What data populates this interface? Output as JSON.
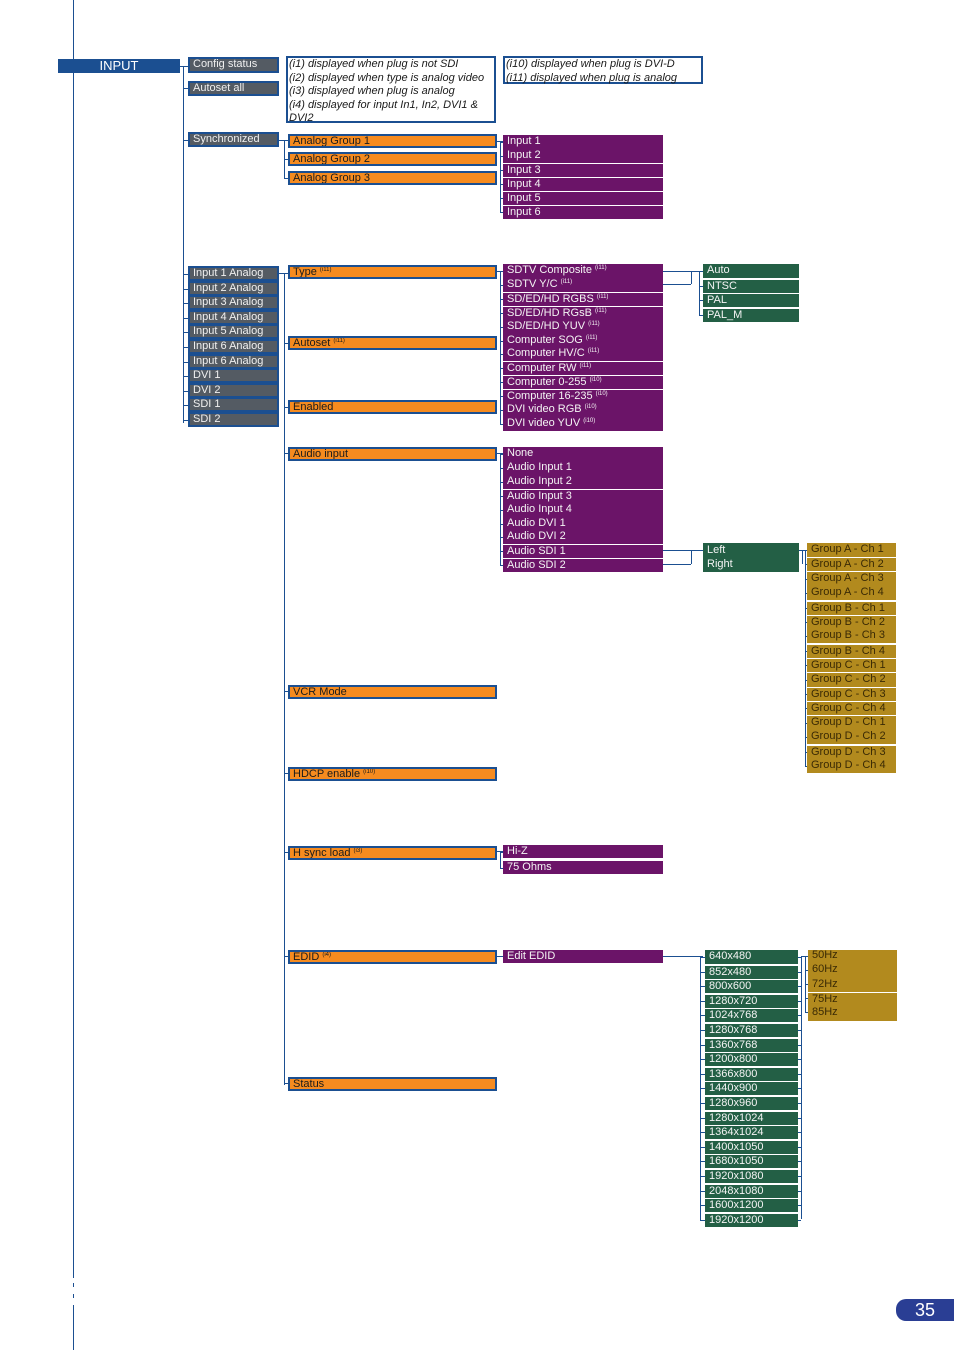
{
  "root": {
    "label": "INPUT"
  },
  "level1": {
    "config_status": "Config status",
    "autoset_all": "Autoset all",
    "synchronized": "Synchronized",
    "inputs": [
      "Input 1 Analog",
      "Input 2 Analog",
      "Input 3 Analog",
      "Input 4 Analog",
      "Input 5 Analog",
      "Input 6 Analog",
      "Input 6 Analog",
      "DVI 1",
      "DVI 2",
      "SDI 1",
      "SDI 2"
    ]
  },
  "notes": {
    "left": [
      "(i1) displayed when plug is not SDI",
      "(i2) displayed when type is analog video",
      "(i3) displayed when plug is analog",
      "(i4) displayed for input In1, In2, DVI1 &",
      "DVI2"
    ],
    "right": [
      "(i10) displayed when plug is DVI-D",
      "(i11) displayed when plug is analog"
    ]
  },
  "analog_groups": [
    "Analog Group 1",
    "Analog Group 2",
    "Analog Group 3"
  ],
  "group_inputs": [
    "Input 1",
    "Input 2",
    "Input 3",
    "Input 4",
    "Input 5",
    "Input 6"
  ],
  "settings": {
    "type": {
      "label": "Type",
      "sup": "(i11)"
    },
    "autoset": {
      "label": "Autoset",
      "sup": "(i11)"
    },
    "enabled": {
      "label": "Enabled"
    },
    "audio_input": {
      "label": "Audio input"
    },
    "vcr_mode": {
      "label": "VCR Mode"
    },
    "hdcp_enable": {
      "label": "HDCP enable",
      "sup": "(i10)"
    },
    "h_sync_load": {
      "label": "H sync load",
      "sup": "(i3)"
    },
    "edid": {
      "label": "EDID",
      "sup": "(i4)"
    },
    "status": {
      "label": "Status"
    }
  },
  "types": [
    {
      "label": "SDTV Composite",
      "sup": "(i11)"
    },
    {
      "label": "SDTV Y/C",
      "sup": "(i11)"
    },
    {
      "label": "SD/ED/HD RGBS",
      "sup": "(i11)"
    },
    {
      "label": "SD/ED/HD RGsB",
      "sup": "(i11)"
    },
    {
      "label": "SD/ED/HD YUV",
      "sup": "(i11)"
    },
    {
      "label": "Computer SOG",
      "sup": "(i11)"
    },
    {
      "label": "Computer HV/C",
      "sup": "(i11)"
    },
    {
      "label": "Computer RW",
      "sup": "(i11)"
    },
    {
      "label": "Computer 0-255",
      "sup": "(i10)"
    },
    {
      "label": "Computer 16-235",
      "sup": "(i10)"
    },
    {
      "label": "DVI video RGB",
      "sup": "(i10)"
    },
    {
      "label": "DVI video YUV",
      "sup": "(i10)"
    }
  ],
  "video_standards": [
    "Auto",
    "NTSC",
    "PAL",
    "PAL_M"
  ],
  "audio_sources": [
    "None",
    "Audio Input 1",
    "Audio Input 2",
    "Audio Input 3",
    "Audio Input 4",
    "Audio DVI 1",
    "Audio DVI 2",
    "Audio SDI 1",
    "Audio SDI 2"
  ],
  "channels_lr": [
    "Left",
    "Right"
  ],
  "sdi_groups": [
    "Group A - Ch 1",
    "Group A - Ch 2",
    "Group A - Ch 3",
    "Group A - Ch 4",
    "Group B - Ch 1",
    "Group B - Ch 2",
    "Group B - Ch 3",
    "Group B - Ch 4",
    "Group C - Ch 1",
    "Group C - Ch 2",
    "Group C - Ch 3",
    "Group C - Ch 4",
    "Group D - Ch 1",
    "Group D - Ch 2",
    "Group D - Ch 3",
    "Group D - Ch 4"
  ],
  "hsync_options": [
    "Hi-Z",
    "75 Ohms"
  ],
  "edit_edid": "Edit EDID",
  "resolutions": [
    "640x480",
    "852x480",
    "800x600",
    "1280x720",
    "1024x768",
    "1280x768",
    "1360x768",
    "1200x800",
    "1366x800",
    "1440x900",
    "1280x960",
    "1280x1024",
    "1364x1024",
    "1400x1050",
    "1680x1050",
    "1920x1080",
    "2048x1080",
    "1600x1200",
    "1920x1200"
  ],
  "refresh_rates": [
    "50Hz",
    "60Hz",
    "72Hz",
    "75Hz",
    "85Hz"
  ],
  "page_number": "35",
  "colors": {
    "blue": "#1b4f91",
    "orange": "#f68b1f",
    "purple": "#6b1468",
    "green": "#235f45",
    "gold": "#b28a1e",
    "grey": "#545b63"
  }
}
